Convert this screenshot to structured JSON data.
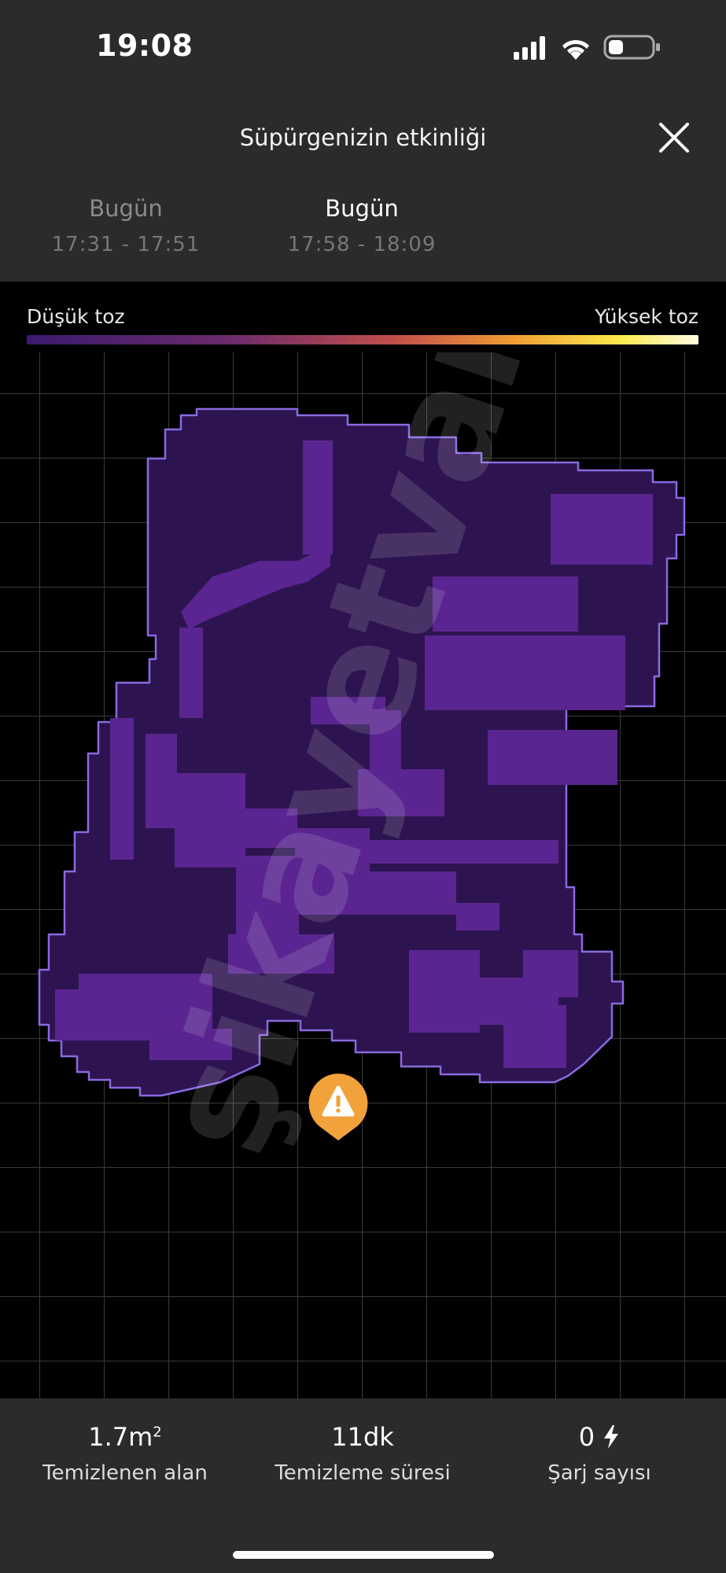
{
  "status_bar": {
    "time": "19:08",
    "icons": [
      "signal-icon",
      "wifi-icon",
      "battery-icon"
    ]
  },
  "header": {
    "title": "Süpürgenizin etkinliği",
    "close_icon": "close-icon"
  },
  "sessions": [
    {
      "day": "Bugün",
      "range": "17:31 - 17:51",
      "active": false
    },
    {
      "day": "Bugün",
      "range": "17:58 - 18:09",
      "active": true
    }
  ],
  "legend": {
    "low_label": "Düşük toz",
    "high_label": "Yüksek toz"
  },
  "map": {
    "marker_icon": "warning-icon",
    "watermark": "şikayetvar"
  },
  "stats": {
    "area_value": "1.7m",
    "area_unit_sup": "2",
    "area_label": "Temizlenen alan",
    "time_value": "11dk",
    "time_label": "Temizleme süresi",
    "charge_value": "0",
    "charge_icon": "lightning-icon",
    "charge_label": "Şarj sayısı"
  },
  "colors": {
    "floor": "#2d1450",
    "dust": "#5a2590",
    "outline": "#8a6ae0",
    "marker": "#f2a23a",
    "panel": "#2b2b2b"
  }
}
